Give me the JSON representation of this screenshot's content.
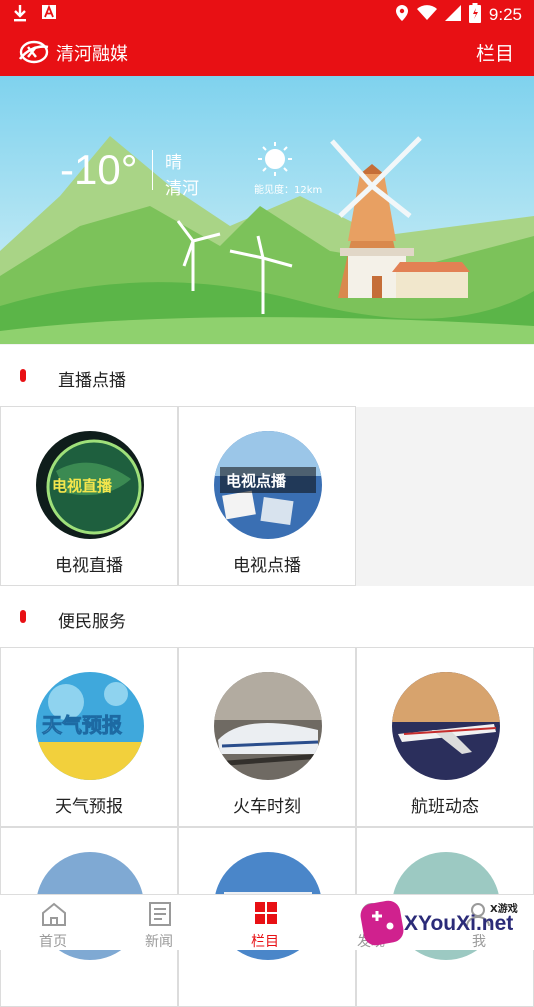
{
  "status_bar": {
    "time": "9:25"
  },
  "app_bar": {
    "title": "清河融媒",
    "action": "栏目"
  },
  "weather": {
    "temperature": "-10°",
    "condition": "晴",
    "city": "清河",
    "visibility": "能见度：12km"
  },
  "sections": [
    {
      "title": "直播点播",
      "items": [
        {
          "label": "电视直播",
          "thumb_text": "电视直播"
        },
        {
          "label": "电视点播",
          "thumb_text": "电视点播"
        }
      ]
    },
    {
      "title": "便民服务",
      "items": [
        {
          "label": "天气预报",
          "thumb_text": "天气预报"
        },
        {
          "label": "火车时刻"
        },
        {
          "label": "航班动态"
        }
      ]
    }
  ],
  "tabs": [
    {
      "label": "首页",
      "icon": "home-icon"
    },
    {
      "label": "新闻",
      "icon": "news-icon"
    },
    {
      "label": "栏目",
      "icon": "grid-icon",
      "active": true
    },
    {
      "label": "发现",
      "icon": "discover-icon"
    },
    {
      "label": "我",
      "icon": "user-icon"
    }
  ],
  "watermark": {
    "text": "XYouXi.net",
    "small": "X游戏"
  },
  "colors": {
    "brand": "#e81014",
    "tab_inactive": "#9a9a9a"
  }
}
